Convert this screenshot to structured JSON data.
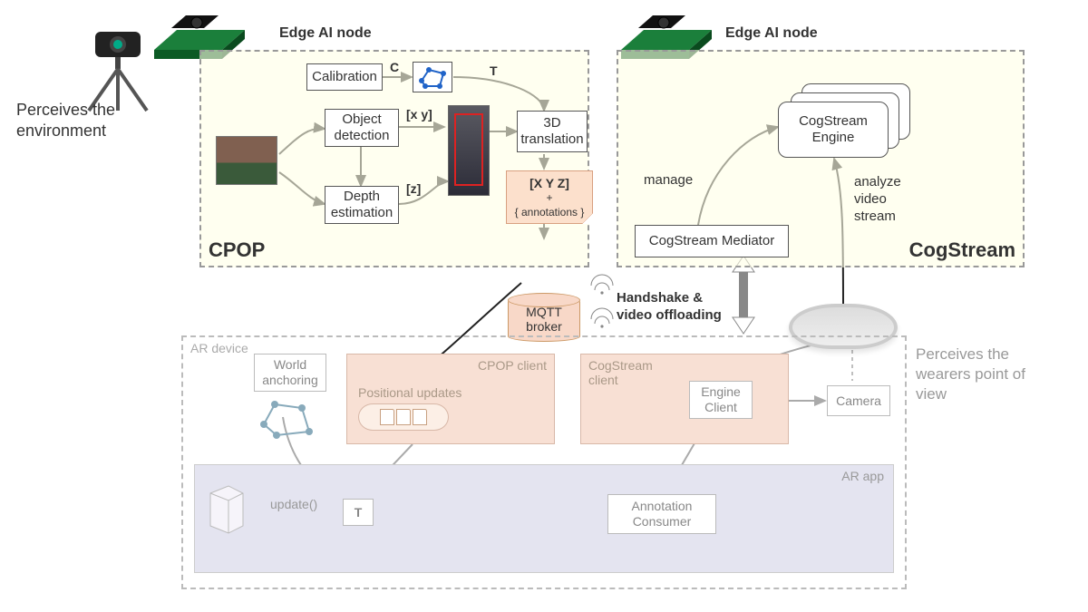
{
  "labels": {
    "edge_left": "Edge AI node",
    "edge_right": "Edge AI node",
    "perceives_env": "Perceives the\nenvironment",
    "perceives_wearer": "Perceives the\nwearers point of\nview"
  },
  "cpop": {
    "title": "CPOP",
    "calibration": "Calibration",
    "object_detection": "Object\ndetection",
    "depth_estimation": "Depth\nestimation",
    "translation3d": "3D\ntranslation",
    "c": "C",
    "T": "T",
    "xy": "[x  y]",
    "z": "[z]",
    "output_vec": "[X  Y  Z]",
    "output_annot": "+\n{ annotations }",
    "mqtt": "MQTT\nbroker"
  },
  "cogstream": {
    "title": "CogStream",
    "engine": "CogStream\nEngine",
    "mediator": "CogStream Mediator",
    "manage": "manage",
    "analyze": "analyze\nvideo\nstream"
  },
  "comm": {
    "handshake": "Handshake &\nvideo offloading"
  },
  "ar": {
    "device": "AR device",
    "world_anchoring": "World\nanchoring",
    "cpop_client": "CPOP client",
    "positional": "Positional updates",
    "cog_client": "CogStream\nclient",
    "engine_client": "Engine\nClient",
    "camera": "Camera",
    "ar_app": "AR app",
    "update": "update()",
    "T": "T",
    "annot_consumer": "Annotation\nConsumer"
  }
}
